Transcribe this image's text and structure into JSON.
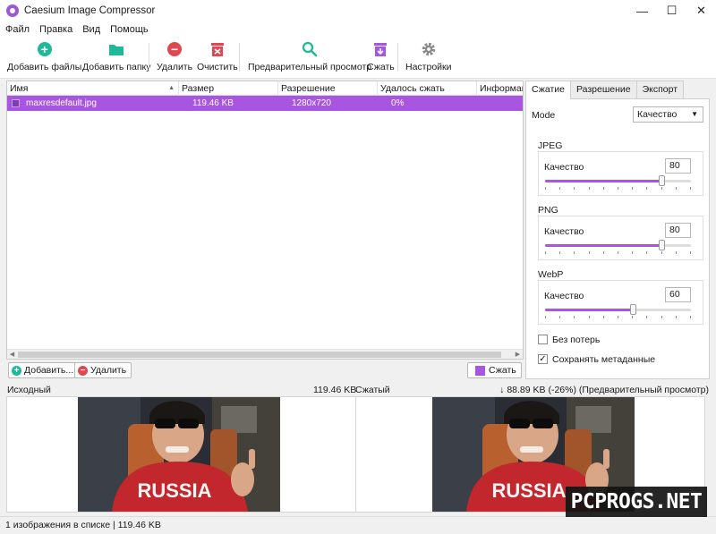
{
  "window": {
    "title": "Caesium Image Compressor"
  },
  "menu": [
    "Файл",
    "Правка",
    "Вид",
    "Помощь"
  ],
  "toolbar": {
    "add_files": "Добавить файлы",
    "add_folder": "Добавить папку",
    "remove": "Удалить",
    "clear": "Очистить",
    "preview": "Предварительный просмотр",
    "compress": "Сжать",
    "settings": "Настройки"
  },
  "file_list": {
    "columns": [
      "Имя",
      "Размер",
      "Разрешение",
      "Удалось сжать",
      "Информаци"
    ],
    "rows": [
      {
        "name": "maxresdefault.jpg",
        "size": "119.46 KB",
        "resolution": "1280x720",
        "saved": "0%"
      }
    ]
  },
  "list_buttons": {
    "add": "Добавить...",
    "remove": "Удалить",
    "compress": "Сжать"
  },
  "panel": {
    "tabs": [
      "Сжатие",
      "Разрешение",
      "Экспорт"
    ],
    "mode_label": "Mode",
    "mode_value": "Качество",
    "jpeg": {
      "title": "JPEG",
      "label": "Качество",
      "value": "80",
      "level": 0.8
    },
    "png": {
      "title": "PNG",
      "label": "Качество",
      "value": "80",
      "level": 0.8
    },
    "webp": {
      "title": "WebP",
      "label": "Качество",
      "value": "60",
      "level": 0.6
    },
    "lossless": {
      "label": "Без потерь",
      "checked": false
    },
    "keep_metadata": {
      "label": "Сохранять метаданные",
      "checked": true
    }
  },
  "original": {
    "label": "Исходный",
    "size": "119.46 KB"
  },
  "compressed": {
    "label": "Сжатый",
    "info": "↓ 88.89 KB (-26%) (Предварительный просмотр)"
  },
  "photo": {
    "shirt_text": "RUSSIA"
  },
  "status": {
    "text": "1 изображения в списке | 119.46 KB"
  },
  "watermark": {
    "text": "PCPROGS.NET"
  },
  "colors": {
    "accent": "#a855e0",
    "teal": "#1fb89a",
    "red": "#e0484f"
  }
}
